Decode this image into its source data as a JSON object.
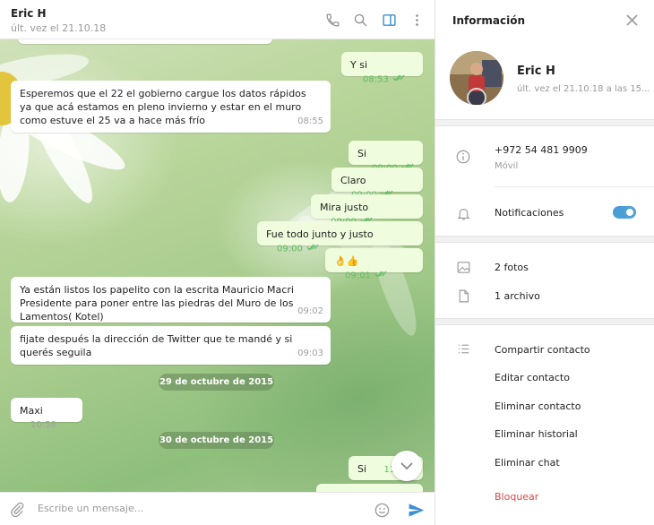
{
  "header": {
    "contact_name": "Eric H",
    "status": "últ. vez el 21.10.18"
  },
  "messages": [
    {
      "id": "m1",
      "direction": "out",
      "text": "Y si",
      "time": "08:53",
      "read": true
    },
    {
      "id": "m2",
      "direction": "in",
      "text": "Esperemos que el 22 el gobierno cargue los datos rápidos ya que acá estamos en pleno invierno y estar en el muro como  estuve el 25 va a hace más frío",
      "time": "08:55"
    },
    {
      "id": "m3",
      "direction": "out",
      "text": "Si",
      "time": "09:00",
      "read": true
    },
    {
      "id": "m4",
      "direction": "out",
      "text": "Claro",
      "time": "09:00",
      "read": true
    },
    {
      "id": "m5",
      "direction": "out",
      "text": "Mira justo",
      "time": "09:00",
      "read": true
    },
    {
      "id": "m6",
      "direction": "out",
      "text": "Fue todo junto y justo",
      "time": "09:00",
      "read": true
    },
    {
      "id": "m7",
      "direction": "out",
      "text": "👌👍",
      "time": "09:01",
      "read": true
    },
    {
      "id": "m8",
      "direction": "in",
      "text": "Ya están listos los papelito con la escrita Mauricio Macri Presidente para poner entre las piedras del Muro de los Lamentos( Kotel)",
      "time": "09:02"
    },
    {
      "id": "m9",
      "direction": "in",
      "text": "fijate después la dirección de Twitter que te mandé y si querés seguila",
      "time": "09:03"
    },
    {
      "id": "m10",
      "direction": "in",
      "text": "Maxi",
      "time": "10:58"
    },
    {
      "id": "m11",
      "direction": "out",
      "text": "Si",
      "time": "11:4",
      "read": true
    }
  ],
  "date_separators": {
    "first": "29 de octubre de 2015",
    "second": "30 de octubre de 2015"
  },
  "composer": {
    "placeholder": "Escribe un mensaje..."
  },
  "info_panel": {
    "title": "Información",
    "name": "Eric H",
    "status": "últ. vez el 21.10.18 a las 15...",
    "phone": "+972 54 481 9909",
    "phone_label": "Móvil",
    "notifications_label": "Notificaciones",
    "notifications_on": true,
    "photos": "2 fotos",
    "files": "1 archivo",
    "actions": {
      "share": "Compartir contacto",
      "edit": "Editar contacto",
      "delete_contact": "Eliminar contacto",
      "clear_history": "Eliminar historial",
      "delete_chat": "Eliminar chat",
      "block": "Bloquear"
    }
  },
  "colors": {
    "accent": "#4a9ed6",
    "outgoing_bubble": "#effdde",
    "check": "#5fbd62",
    "danger": "#d14b49"
  }
}
